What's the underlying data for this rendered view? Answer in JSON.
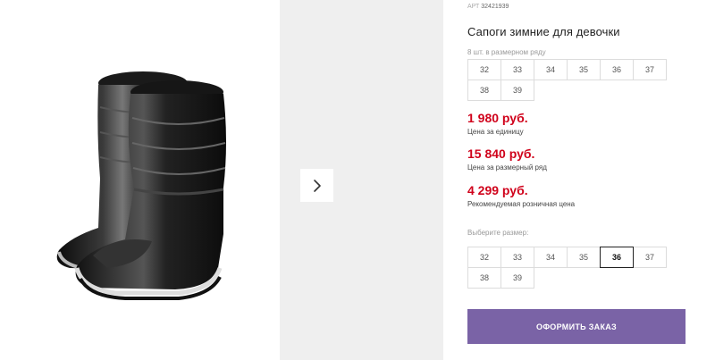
{
  "product": {
    "article_label": "АРТ",
    "article_number": "32421939",
    "title": "Сапоги зимние для девочки",
    "row_caption": "8 шт. в размерном ряду",
    "row_sizes": [
      "32",
      "33",
      "34",
      "35",
      "36",
      "37",
      "38",
      "39"
    ],
    "prices": [
      {
        "value": "1 980 руб.",
        "caption": "Цена за единицу"
      },
      {
        "value": "15 840 руб.",
        "caption": "Цена за размерный ряд"
      },
      {
        "value": "4 299 руб.",
        "caption": "Рекомендуемая розничная цена"
      }
    ],
    "size_picker": {
      "caption": "Выберите размер:",
      "sizes": [
        "32",
        "33",
        "34",
        "35",
        "36",
        "37",
        "38",
        "39"
      ],
      "selected": "36"
    },
    "order_button": "ОФОРМИТЬ ЗАКАЗ"
  },
  "gallery": {
    "next_icon": "chevron-right-icon"
  },
  "colors": {
    "price": "#d0021b",
    "order_button": "#7a63a6",
    "gallery_panel": "#efefef"
  }
}
